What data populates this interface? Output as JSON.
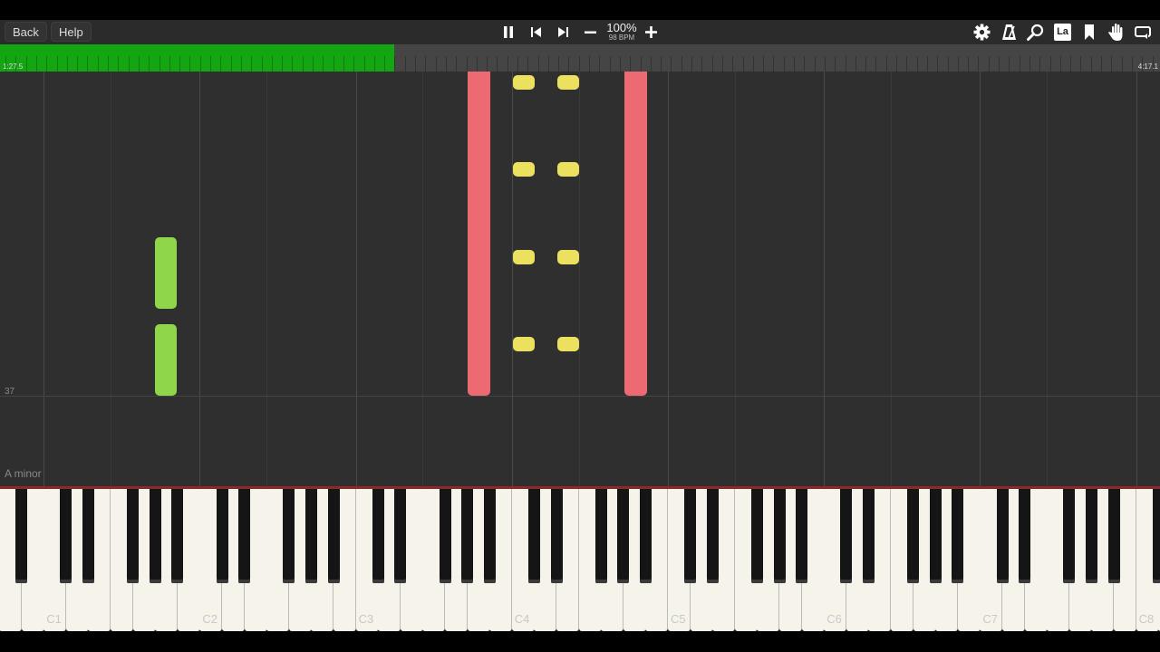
{
  "toolbar": {
    "back_label": "Back",
    "help_label": "Help",
    "zoom": "100%",
    "bpm": "98 BPM",
    "icons": [
      "pause-icon",
      "skip-back-icon",
      "skip-forward-icon",
      "minus-icon",
      "plus-icon",
      "gear-icon",
      "metronome-icon",
      "search-icon",
      "label-icon",
      "bookmark-icon",
      "hand-icon",
      "loop-icon"
    ],
    "label_icon_text": "La"
  },
  "progress": {
    "current_time": "1:27.5",
    "total_time": "4:17.1",
    "fraction": 0.34,
    "color": "#13a612"
  },
  "roll": {
    "measure_number": "37",
    "key_signature": "A minor",
    "colors": {
      "red": "#ee6a72",
      "yellow": "#ece15e",
      "green": "#8fd64a"
    }
  },
  "keyboard": {
    "octave_labels": [
      "C1",
      "C2",
      "C3",
      "C4",
      "C5",
      "C6",
      "C7",
      "C8"
    ]
  }
}
